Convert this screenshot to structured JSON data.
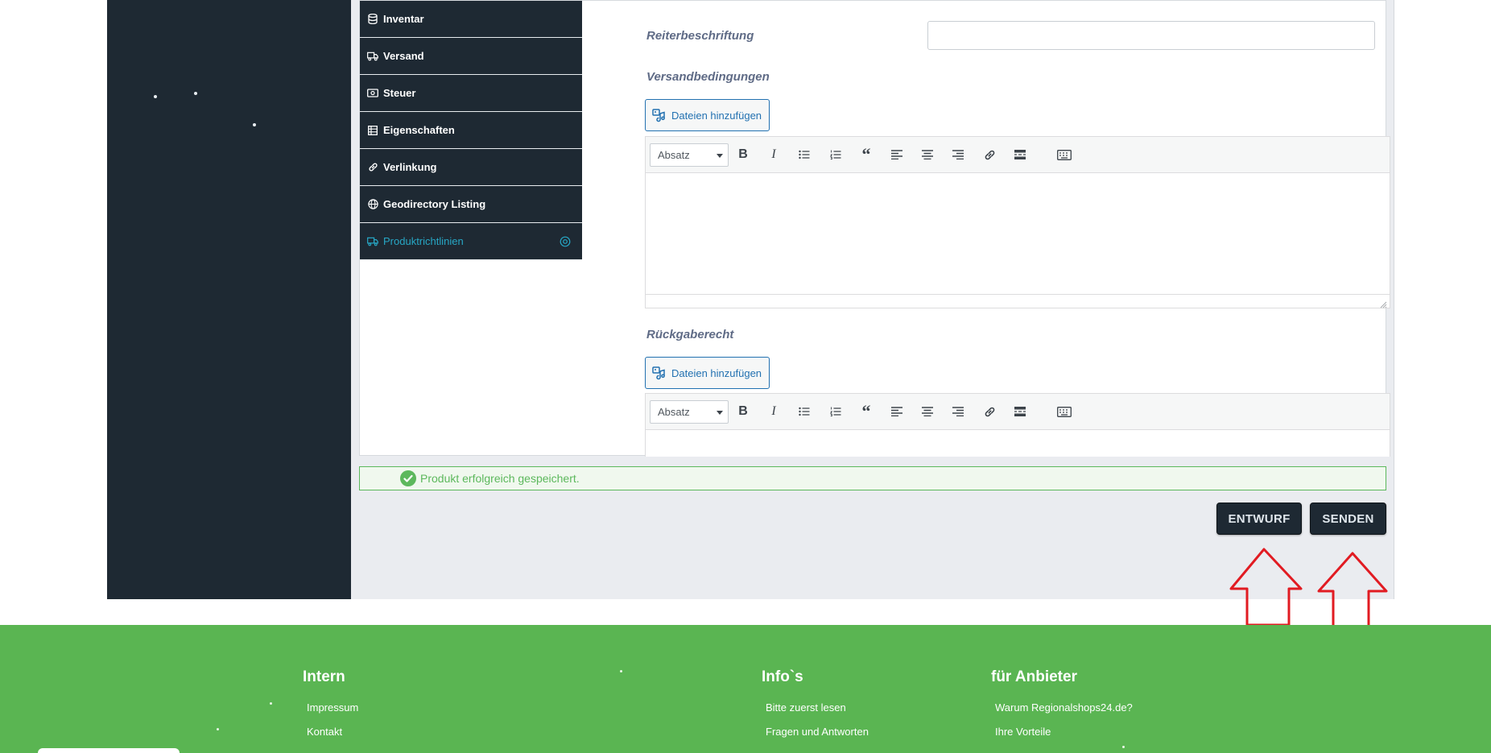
{
  "tabs": [
    {
      "label": "Inventar",
      "icon": "database-icon"
    },
    {
      "label": "Versand",
      "icon": "truck-icon"
    },
    {
      "label": "Steuer",
      "icon": "money-icon"
    },
    {
      "label": "Eigenschaften",
      "icon": "table-icon"
    },
    {
      "label": "Verlinkung",
      "icon": "link-icon"
    },
    {
      "label": "Geodirectory Listing",
      "icon": "globe-icon"
    },
    {
      "label": "Produktrichtlinien",
      "icon": "policy-icon",
      "active": true
    }
  ],
  "fields": {
    "tab_caption_label": "Reiterbeschriftung",
    "tab_caption_value": "",
    "shipping_label": "Versandbedingungen",
    "return_label": "Rückgaberecht",
    "add_media_label": "Dateien hinzufügen",
    "format_select": "Absatz"
  },
  "notice": {
    "text": "Produkt erfolgreich gespeichert."
  },
  "actions": {
    "draft": "ENTWURF",
    "send": "SENDEN"
  },
  "footer": {
    "col1": {
      "heading": "Intern",
      "links": [
        "Impressum",
        "Kontakt"
      ]
    },
    "col2": {
      "heading": "Info`s",
      "links": [
        "Bitte zuerst lesen",
        "Fragen und Antworten"
      ]
    },
    "col3": {
      "heading": "für Anbieter",
      "links": [
        "Warum Regionalshops24.de?",
        "Ihre Vorteile"
      ]
    }
  },
  "colors": {
    "sidebar": "#1e2933",
    "active_tab": "#27a7c5",
    "success": "#5cb85c",
    "footer": "#5ab552",
    "annotation_arrow": "#e11b22"
  }
}
